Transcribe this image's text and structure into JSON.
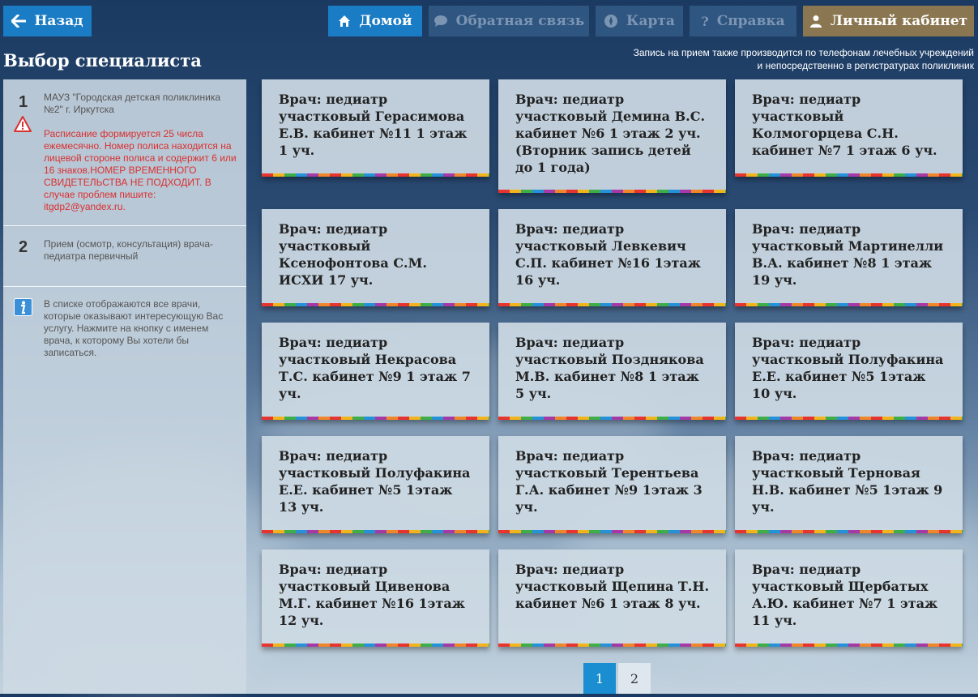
{
  "nav": {
    "back_label": "Назад",
    "home_label": "Домой",
    "feedback_label": "Обратная связь",
    "map_label": "Карта",
    "help_label": "Справка",
    "cabinet_label": "Личный кабинет"
  },
  "page_title": "Выбор специалиста",
  "notice": {
    "line1": "Запись на прием также производится по телефонам лечебных учреждений",
    "line2": "и непосредственно в регистратурах поликлиник"
  },
  "steps": [
    {
      "number": "1",
      "text": "МАУЗ \"Городская детская поликлиника №2\" г. Иркутска",
      "warning": "Расписание формируется 25 числа ежемесячно. Номер полиса находится на лицевой стороне полиса и содержит 6 или 16 знаков.НОМЕР ВРЕМЕННОГО СВИДЕТЕЛЬСТВА НЕ ПОДХОДИТ. В случае проблем пишите: itgdp2@yandex.ru."
    },
    {
      "number": "2",
      "text": "Прием (осмотр, консультация) врача-педиатра первичный"
    }
  ],
  "info_text": "В списке отображаются все врачи, которые оказывают интересующую Вас услугу. Нажмите на кнопку с именем врача, к которому Вы хотели бы записаться.",
  "doctors": [
    "Врач: педиатр участковый Герасимова Е.В. кабинет №11 1 этаж 1 уч.",
    "Врач: педиатр участковый Демина В.С. кабинет №6 1 этаж 2 уч. (Вторник запись детей до 1 года)",
    "Врач: педиатр участковый Колмогорцева С.Н. кабинет №7 1 этаж 6 уч.",
    "Врач: педиатр участковый Ксенофонтова С.М. ИСХИ 17 уч.",
    "Врач: педиатр участковый Левкевич С.П. кабинет №16 1этаж 16 уч.",
    "Врач: педиатр участковый Мартинелли В.А. кабинет №8 1 этаж 19 уч.",
    "Врач: педиатр участковый Некрасова Т.С. кабинет №9 1 этаж 7 уч.",
    "Врач: педиатр участковый Позднякова М.В. кабинет №8 1 этаж 5 уч.",
    "Врач: педиатр участковый Полуфакина Е.Е. кабинет №5 1этаж 10 уч.",
    "Врач: педиатр участковый Полуфакина Е.Е. кабинет №5 1этаж 13 уч.",
    "Врач: педиатр участковый Терентьева Г.А. кабинет №9 1этаж 3 уч.",
    "Врач: педиатр участковый Терновая Н.В. кабинет №5 1этаж 9 уч.",
    "Врач: педиатр участковый Цивенова М.Г. кабинет №16 1этаж 12 уч.",
    "Врач: педиатр участковый Щепина Т.Н. кабинет №6 1 этаж 8 уч.",
    "Врач: педиатр участковый Щербатых А.Ю. кабинет №7 1 этаж 11 уч."
  ],
  "pagination": {
    "page1": "1",
    "page2": "2"
  },
  "colors": {
    "primary": "#1a7cc4",
    "disabled": "#2f5681",
    "cabinet": "#8a7650",
    "warning": "#d93030"
  }
}
